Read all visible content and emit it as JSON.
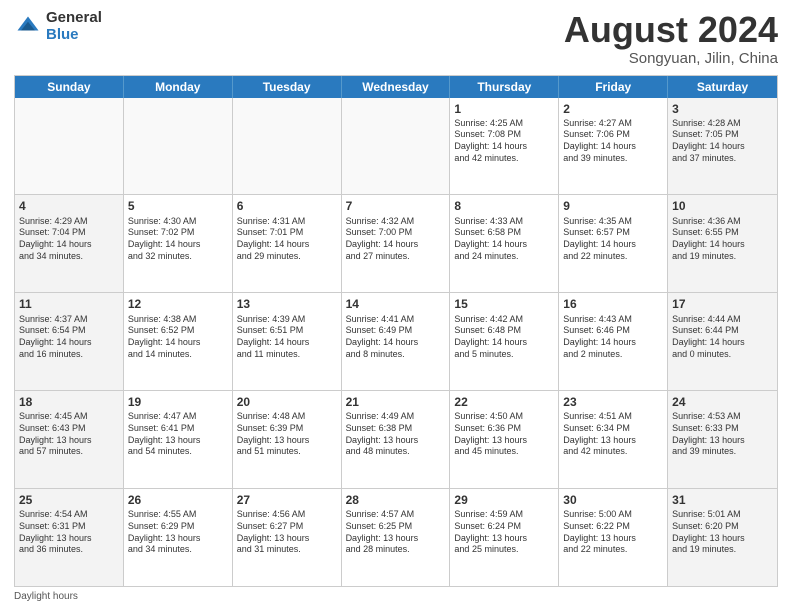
{
  "logo": {
    "general": "General",
    "blue": "Blue"
  },
  "title": {
    "month_year": "August 2024",
    "location": "Songyuan, Jilin, China"
  },
  "days_of_week": [
    "Sunday",
    "Monday",
    "Tuesday",
    "Wednesday",
    "Thursday",
    "Friday",
    "Saturday"
  ],
  "footer": {
    "daylight_hours": "Daylight hours"
  },
  "weeks": [
    [
      {
        "day": "",
        "detail": ""
      },
      {
        "day": "",
        "detail": ""
      },
      {
        "day": "",
        "detail": ""
      },
      {
        "day": "",
        "detail": ""
      },
      {
        "day": "1",
        "detail": "Sunrise: 4:25 AM\nSunset: 7:08 PM\nDaylight: 14 hours\nand 42 minutes."
      },
      {
        "day": "2",
        "detail": "Sunrise: 4:27 AM\nSunset: 7:06 PM\nDaylight: 14 hours\nand 39 minutes."
      },
      {
        "day": "3",
        "detail": "Sunrise: 4:28 AM\nSunset: 7:05 PM\nDaylight: 14 hours\nand 37 minutes."
      }
    ],
    [
      {
        "day": "4",
        "detail": "Sunrise: 4:29 AM\nSunset: 7:04 PM\nDaylight: 14 hours\nand 34 minutes."
      },
      {
        "day": "5",
        "detail": "Sunrise: 4:30 AM\nSunset: 7:02 PM\nDaylight: 14 hours\nand 32 minutes."
      },
      {
        "day": "6",
        "detail": "Sunrise: 4:31 AM\nSunset: 7:01 PM\nDaylight: 14 hours\nand 29 minutes."
      },
      {
        "day": "7",
        "detail": "Sunrise: 4:32 AM\nSunset: 7:00 PM\nDaylight: 14 hours\nand 27 minutes."
      },
      {
        "day": "8",
        "detail": "Sunrise: 4:33 AM\nSunset: 6:58 PM\nDaylight: 14 hours\nand 24 minutes."
      },
      {
        "day": "9",
        "detail": "Sunrise: 4:35 AM\nSunset: 6:57 PM\nDaylight: 14 hours\nand 22 minutes."
      },
      {
        "day": "10",
        "detail": "Sunrise: 4:36 AM\nSunset: 6:55 PM\nDaylight: 14 hours\nand 19 minutes."
      }
    ],
    [
      {
        "day": "11",
        "detail": "Sunrise: 4:37 AM\nSunset: 6:54 PM\nDaylight: 14 hours\nand 16 minutes."
      },
      {
        "day": "12",
        "detail": "Sunrise: 4:38 AM\nSunset: 6:52 PM\nDaylight: 14 hours\nand 14 minutes."
      },
      {
        "day": "13",
        "detail": "Sunrise: 4:39 AM\nSunset: 6:51 PM\nDaylight: 14 hours\nand 11 minutes."
      },
      {
        "day": "14",
        "detail": "Sunrise: 4:41 AM\nSunset: 6:49 PM\nDaylight: 14 hours\nand 8 minutes."
      },
      {
        "day": "15",
        "detail": "Sunrise: 4:42 AM\nSunset: 6:48 PM\nDaylight: 14 hours\nand 5 minutes."
      },
      {
        "day": "16",
        "detail": "Sunrise: 4:43 AM\nSunset: 6:46 PM\nDaylight: 14 hours\nand 2 minutes."
      },
      {
        "day": "17",
        "detail": "Sunrise: 4:44 AM\nSunset: 6:44 PM\nDaylight: 14 hours\nand 0 minutes."
      }
    ],
    [
      {
        "day": "18",
        "detail": "Sunrise: 4:45 AM\nSunset: 6:43 PM\nDaylight: 13 hours\nand 57 minutes."
      },
      {
        "day": "19",
        "detail": "Sunrise: 4:47 AM\nSunset: 6:41 PM\nDaylight: 13 hours\nand 54 minutes."
      },
      {
        "day": "20",
        "detail": "Sunrise: 4:48 AM\nSunset: 6:39 PM\nDaylight: 13 hours\nand 51 minutes."
      },
      {
        "day": "21",
        "detail": "Sunrise: 4:49 AM\nSunset: 6:38 PM\nDaylight: 13 hours\nand 48 minutes."
      },
      {
        "day": "22",
        "detail": "Sunrise: 4:50 AM\nSunset: 6:36 PM\nDaylight: 13 hours\nand 45 minutes."
      },
      {
        "day": "23",
        "detail": "Sunrise: 4:51 AM\nSunset: 6:34 PM\nDaylight: 13 hours\nand 42 minutes."
      },
      {
        "day": "24",
        "detail": "Sunrise: 4:53 AM\nSunset: 6:33 PM\nDaylight: 13 hours\nand 39 minutes."
      }
    ],
    [
      {
        "day": "25",
        "detail": "Sunrise: 4:54 AM\nSunset: 6:31 PM\nDaylight: 13 hours\nand 36 minutes."
      },
      {
        "day": "26",
        "detail": "Sunrise: 4:55 AM\nSunset: 6:29 PM\nDaylight: 13 hours\nand 34 minutes."
      },
      {
        "day": "27",
        "detail": "Sunrise: 4:56 AM\nSunset: 6:27 PM\nDaylight: 13 hours\nand 31 minutes."
      },
      {
        "day": "28",
        "detail": "Sunrise: 4:57 AM\nSunset: 6:25 PM\nDaylight: 13 hours\nand 28 minutes."
      },
      {
        "day": "29",
        "detail": "Sunrise: 4:59 AM\nSunset: 6:24 PM\nDaylight: 13 hours\nand 25 minutes."
      },
      {
        "day": "30",
        "detail": "Sunrise: 5:00 AM\nSunset: 6:22 PM\nDaylight: 13 hours\nand 22 minutes."
      },
      {
        "day": "31",
        "detail": "Sunrise: 5:01 AM\nSunset: 6:20 PM\nDaylight: 13 hours\nand 19 minutes."
      }
    ]
  ]
}
